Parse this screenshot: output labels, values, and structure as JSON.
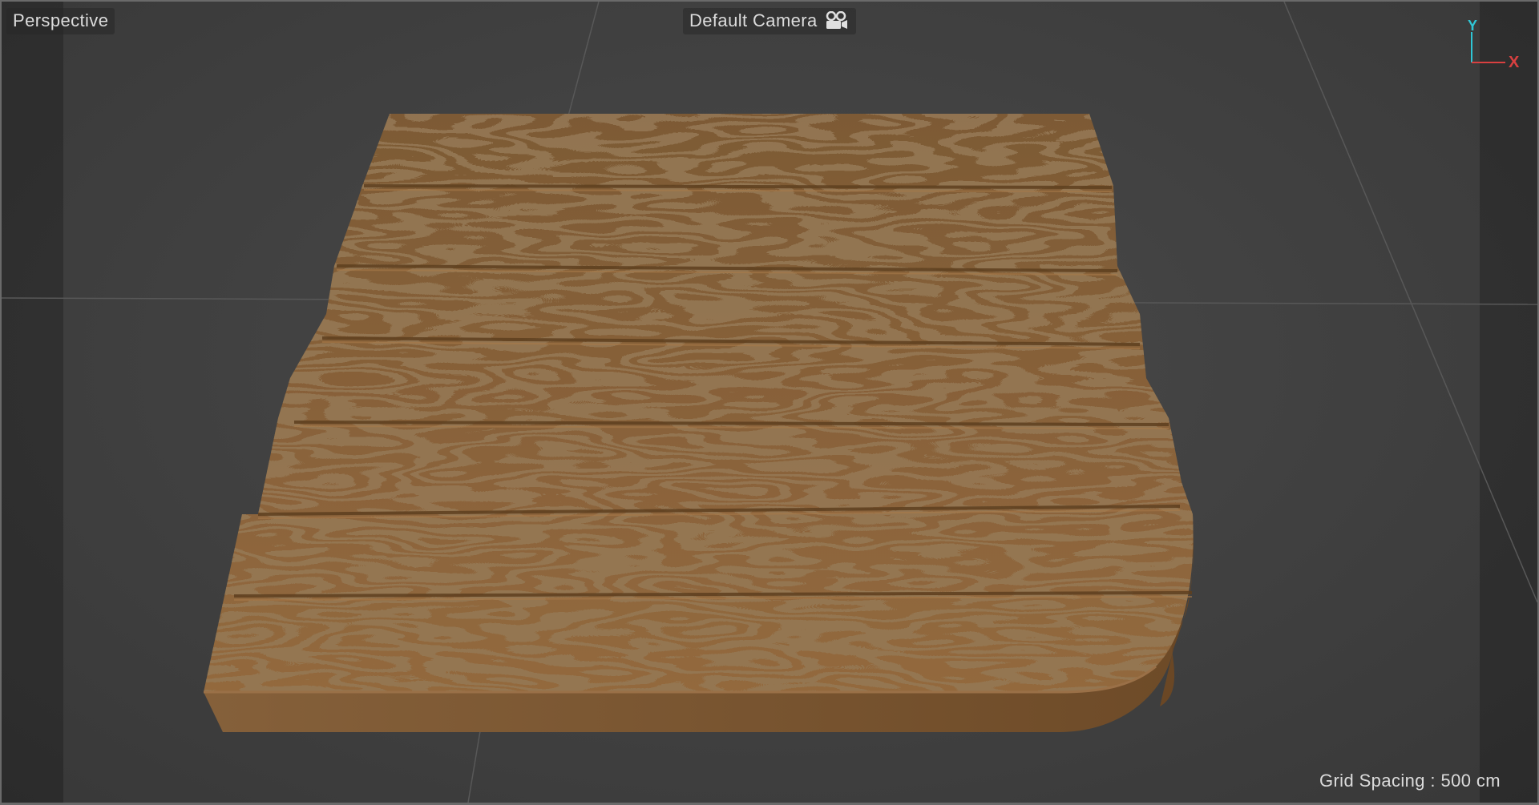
{
  "viewport": {
    "view_name": "Perspective",
    "camera_name": "Default Camera",
    "camera_icon": "camera-icon",
    "grid_spacing": "Grid Spacing : 500 cm"
  },
  "axis_gizmo": {
    "y_label": "Y",
    "x_label": "X",
    "y_color": "#2fc6d6",
    "x_color": "#d94040"
  },
  "scene": {
    "object": "wooden-plank-floor-block",
    "wood_color": "#8a6238",
    "wood_dark": "#4e3116",
    "side_color": "#7a542d",
    "background_color": "#404040",
    "grid_line_color": "#555555"
  }
}
